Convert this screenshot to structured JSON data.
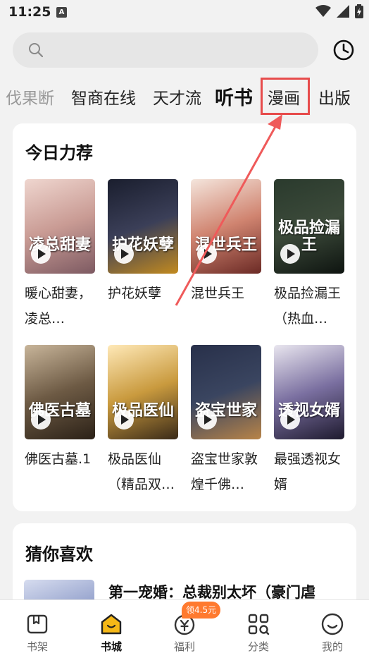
{
  "status_bar": {
    "time": "11:25",
    "notification_glyph": "A"
  },
  "search": {
    "placeholder": ""
  },
  "tabs": [
    {
      "label": "伐果断",
      "state": "faded"
    },
    {
      "label": "智商在线",
      "state": "normal"
    },
    {
      "label": "天才流",
      "state": "normal"
    },
    {
      "label": "听书",
      "state": "active"
    },
    {
      "label": "漫画",
      "state": "highlighted"
    },
    {
      "label": "出版",
      "state": "normal"
    }
  ],
  "recommend": {
    "title": "今日力荐",
    "books": [
      {
        "title": "暖心甜妻，凌总…",
        "cover_text": "凌总甜妻"
      },
      {
        "title": "护花妖孽",
        "cover_text": "护花妖孽"
      },
      {
        "title": "混世兵王",
        "cover_text": "混世兵王"
      },
      {
        "title": "极品捡漏王（热血…",
        "cover_text": "极品捡漏王"
      },
      {
        "title": "佛医古墓.1",
        "cover_text": "佛医古墓"
      },
      {
        "title": "极品医仙（精品双…",
        "cover_text": "极品医仙"
      },
      {
        "title": "盗宝世家敦煌千佛…",
        "cover_text": "盗宝世家"
      },
      {
        "title": "最强透视女婿",
        "cover_text": "透视女婿"
      }
    ]
  },
  "guess": {
    "title": "猜你喜欢",
    "items": [
      {
        "title": "第一宠婚：总裁别太坏（豪门虐"
      }
    ]
  },
  "reward_badge": "领4.5元",
  "bottom_nav": [
    {
      "label": "书架",
      "icon": "bookshelf-icon",
      "active": false
    },
    {
      "label": "书城",
      "icon": "bookstore-home-icon",
      "active": true
    },
    {
      "label": "福利",
      "icon": "welfare-coin-icon",
      "active": false
    },
    {
      "label": "分类",
      "icon": "category-grid-icon",
      "active": false
    },
    {
      "label": "我的",
      "icon": "profile-smile-icon",
      "active": false
    }
  ],
  "colors": {
    "highlight": "#e74c4c",
    "badge": "#ff7a2f",
    "nav_active": "#f5b817"
  }
}
